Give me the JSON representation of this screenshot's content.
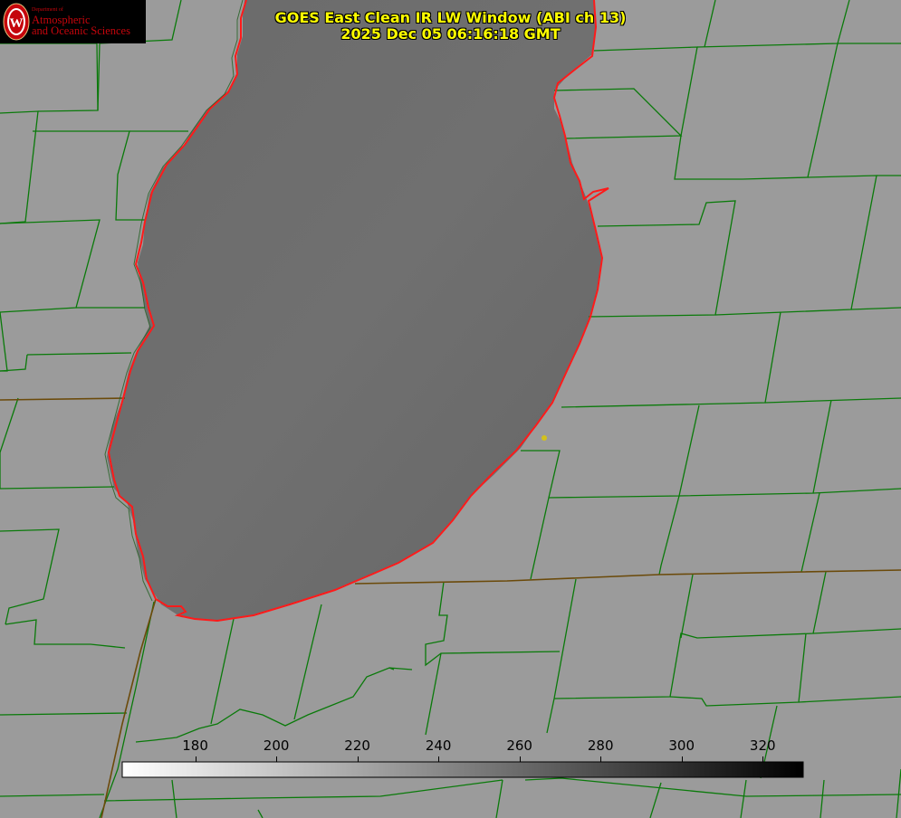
{
  "title": {
    "line1": "GOES East Clean IR LW Window (ABI ch 13)",
    "line2": "2025 Dec 05 06:16:18 GMT"
  },
  "logo": {
    "dept_text": "Department of",
    "line1": "Atmospheric",
    "line2": "and Oceanic Sciences",
    "seal_letter": "W"
  },
  "colorbar": {
    "ticks": [
      "180",
      "200",
      "220",
      "240",
      "260",
      "280",
      "300",
      "320"
    ],
    "range": [
      162,
      330
    ],
    "colors": [
      "#ffffff",
      "#000000"
    ]
  },
  "colors": {
    "background": "#9b9b9b",
    "lake": "#6e6e6e",
    "county_lines": "#0a7a0a",
    "coastline": "#ff1a1a",
    "title": "#ffff00",
    "logo_red": "#c5050c"
  },
  "marker": {
    "color": "#d4c21a"
  }
}
